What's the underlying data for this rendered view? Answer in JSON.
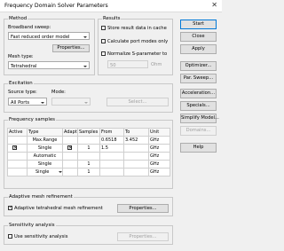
{
  "window": {
    "title": "Frequency Domain Solver Parameters",
    "close": "✕"
  },
  "method": {
    "title": "Method",
    "broadband_label": "Broadband sweep:",
    "broadband_value": "Fast reduced order model",
    "properties_label": "Properties...",
    "mesh_label": "Mesh type:",
    "mesh_value": "Tetrahedral"
  },
  "results": {
    "title": "Results",
    "store_label": "Store result data in cache",
    "calc_ports_label": "Calculate port modes only",
    "normalize_label": "Normalize S-parameter to",
    "normalize_value": "50",
    "normalize_unit": "Ohm"
  },
  "side_buttons": {
    "start": "Start",
    "close": "Close",
    "apply": "Apply",
    "optimizer": "Optimizer...",
    "par_sweep": "Par. Sweep...",
    "acceleration": "Acceleration...",
    "specials": "Specials...",
    "simplify_model": "Simplify Model...",
    "domains": "Domains...",
    "help": "Help"
  },
  "excitation": {
    "title": "Excitation",
    "source_label": "Source type:",
    "source_value": "All Ports",
    "mode_label": "Mode:",
    "mode_value": "",
    "select_label": "Select..."
  },
  "freq_samples": {
    "title": "Frequency samples",
    "headers": [
      "Active",
      "Type",
      "Adapt.",
      "Samples",
      "From",
      "To",
      "Unit"
    ],
    "rows": [
      {
        "active": "",
        "type": "Max.Range",
        "adapt": "",
        "samples": "",
        "from": "0.6518",
        "to": "3.452",
        "unit": "GHz"
      },
      {
        "active": "checked",
        "type": "Single",
        "adapt": "checked",
        "samples": "1",
        "from": "1.5",
        "to": "",
        "unit": "GHz"
      },
      {
        "active": "",
        "type": "Automatic",
        "adapt": "",
        "samples": "",
        "from": "",
        "to": "",
        "unit": "GHz"
      },
      {
        "active": "",
        "type": "Single",
        "adapt": "",
        "samples": "1",
        "from": "",
        "to": "",
        "unit": "GHz"
      },
      {
        "active": "",
        "type": "Single",
        "adapt": "",
        "samples": "1",
        "from": "",
        "to": "",
        "unit": "GHz"
      }
    ]
  },
  "adaptive": {
    "title": "Adaptive mesh refinement",
    "checkbox_label": "Adaptive tetrahedral mesh refinement",
    "properties_label": "Properties..."
  },
  "sensitivity": {
    "title": "Sensitivity analysis",
    "checkbox_label": "Use sensitivity analysis",
    "properties_label": "Properties..."
  }
}
